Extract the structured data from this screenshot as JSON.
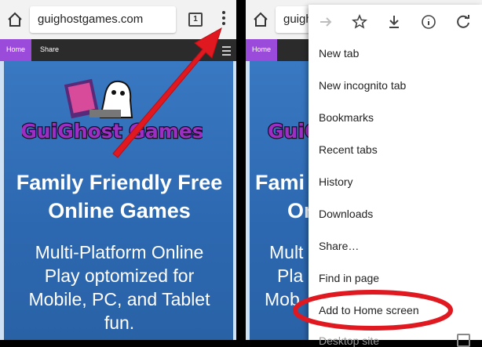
{
  "left_browser": {
    "url": "guighostgames.com",
    "tab_count": "1",
    "site_nav": {
      "home": "Home",
      "share": "Share"
    },
    "logo_text": "GuiGhost Games",
    "headline": [
      "Family Friendly Free",
      "Online Games"
    ],
    "subtext": [
      "Multi-Platform Online",
      "Play optomized for",
      "Mobile, PC, and Tablet",
      "fun."
    ]
  },
  "right_browser": {
    "url": "guigh",
    "site_nav": {
      "home": "Home"
    },
    "logo_text": "GuiGh",
    "headline": [
      "Fami",
      "On"
    ],
    "subtext": [
      "Mult",
      "Pla",
      "Mob"
    ],
    "menu": {
      "icons": [
        "forward-arrow-icon",
        "star-icon",
        "download-icon",
        "info-icon",
        "refresh-icon"
      ],
      "items": [
        "New tab",
        "New incognito tab",
        "Bookmarks",
        "Recent tabs",
        "History",
        "Downloads",
        "Share…",
        "Find in page",
        "Add to Home screen",
        "Desktop site"
      ]
    }
  },
  "colors": {
    "annotation_red": "#e0181f",
    "site_background": "#2f6fb5",
    "nav_home": "#9b4bd9"
  }
}
